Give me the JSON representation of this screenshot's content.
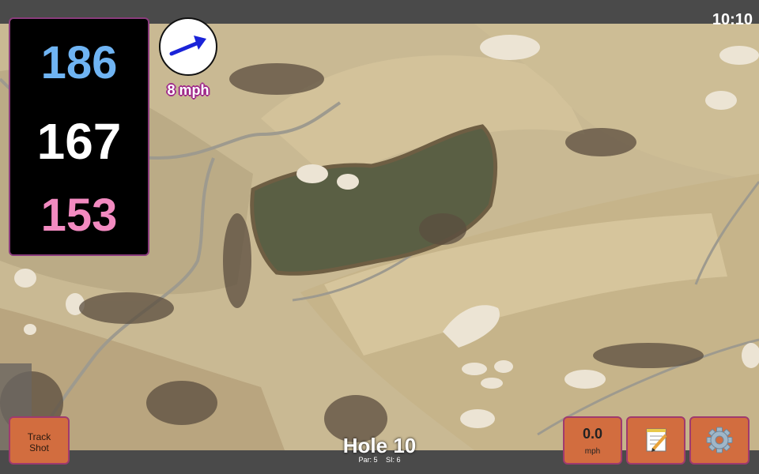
{
  "status": {
    "clock": "10:10"
  },
  "distances": {
    "back": "186",
    "middle": "167",
    "front": "153"
  },
  "wind": {
    "speed": "8 mph",
    "icon": "wind-arrow-icon",
    "color": "#1a23d8"
  },
  "track_button": {
    "line1": "Track",
    "line2": "Shot"
  },
  "speed_button": {
    "value": "0.0",
    "unit": "mph"
  },
  "notes_button": {
    "icon": "notepad-icon"
  },
  "settings_button": {
    "icon": "gear-icon"
  },
  "hole": {
    "title": "Hole 10",
    "par": "Par: 5",
    "si": "SI: 6"
  },
  "colors": {
    "back": "#6fb4f3",
    "middle": "#ffffff",
    "front": "#f28ac0",
    "button": "#d26d3f",
    "accent": "#a02a8a"
  }
}
